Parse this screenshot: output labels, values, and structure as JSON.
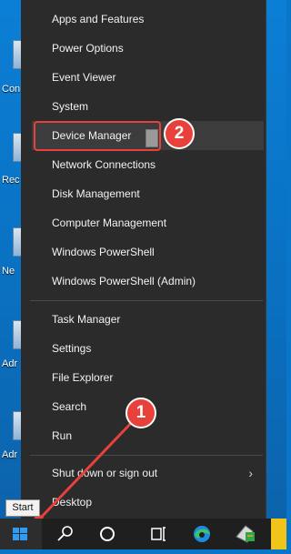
{
  "desktop": {
    "icons": [
      {
        "label": "Con"
      },
      {
        "label": "Rec"
      },
      {
        "label": "Ne"
      },
      {
        "label": "Adr"
      },
      {
        "label": "Adr"
      }
    ]
  },
  "menu": {
    "items": [
      {
        "label": "Apps and Features"
      },
      {
        "label": "Power Options"
      },
      {
        "label": "Event Viewer"
      },
      {
        "label": "System"
      },
      {
        "label": "Device Manager"
      },
      {
        "label": "Network Connections"
      },
      {
        "label": "Disk Management"
      },
      {
        "label": "Computer Management"
      },
      {
        "label": "Windows PowerShell"
      },
      {
        "label": "Windows PowerShell (Admin)"
      },
      {
        "label": "Task Manager"
      },
      {
        "label": "Settings"
      },
      {
        "label": "File Explorer"
      },
      {
        "label": "Search"
      },
      {
        "label": "Run"
      },
      {
        "label": "Shut down or sign out"
      },
      {
        "label": "Desktop"
      }
    ]
  },
  "annotations": {
    "step1": "1",
    "step2": "2"
  },
  "taskbar": {
    "start_tooltip": "Start"
  },
  "colors": {
    "accent": "#0a76c9",
    "annotation": "#e8413c",
    "menu_bg": "#2b2b2b"
  },
  "icons": [
    "windows-start-icon",
    "search-icon",
    "cortana-icon",
    "task-view-icon",
    "edge-icon",
    "app-icon",
    "submenu-chevron-icon"
  ]
}
